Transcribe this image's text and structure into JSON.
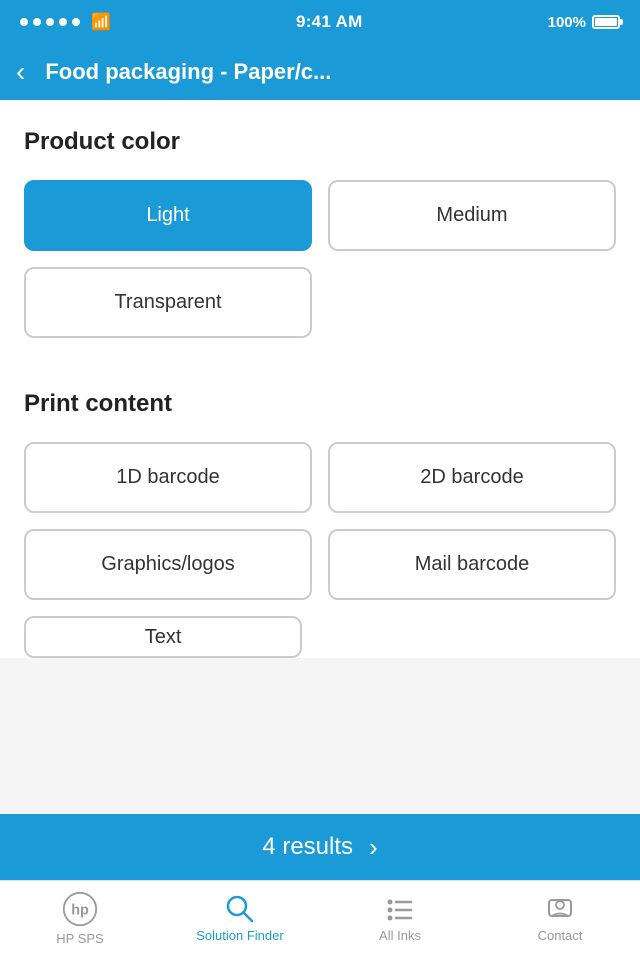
{
  "statusBar": {
    "time": "9:41 AM",
    "battery": "100%"
  },
  "header": {
    "backLabel": "‹",
    "title": "Food packaging - Paper/c..."
  },
  "productColor": {
    "sectionTitle": "Product color",
    "options": [
      {
        "label": "Light",
        "selected": true
      },
      {
        "label": "Medium",
        "selected": false
      },
      {
        "label": "Transparent",
        "selected": false
      }
    ]
  },
  "printContent": {
    "sectionTitle": "Print content",
    "options": [
      {
        "label": "1D barcode",
        "selected": false
      },
      {
        "label": "2D barcode",
        "selected": false
      },
      {
        "label": "Graphics/logos",
        "selected": false
      },
      {
        "label": "Mail barcode",
        "selected": false
      },
      {
        "label": "Text",
        "selected": false
      }
    ]
  },
  "resultsBar": {
    "label": "4 results",
    "chevron": "›"
  },
  "tabBar": {
    "tabs": [
      {
        "id": "hp-sps",
        "label": "HP SPS",
        "active": false
      },
      {
        "id": "solution-finder",
        "label": "Solution Finder",
        "active": true
      },
      {
        "id": "all-inks",
        "label": "All Inks",
        "active": false
      },
      {
        "id": "contact",
        "label": "Contact",
        "active": false
      }
    ]
  }
}
